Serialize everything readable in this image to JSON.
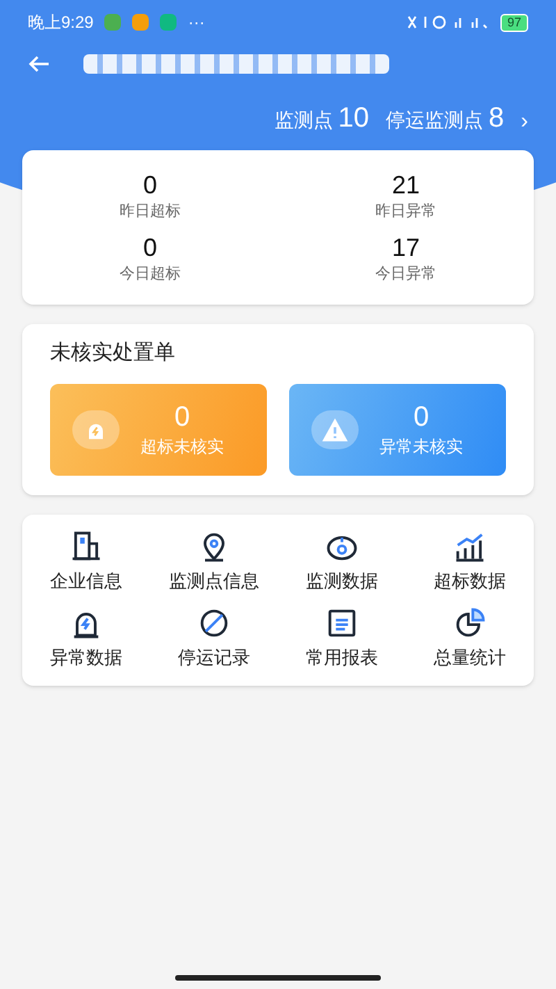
{
  "status_bar": {
    "time": "晚上9:29",
    "more": "···",
    "battery": "97"
  },
  "header": {
    "counts": [
      {
        "label": "监测点",
        "value": "10"
      },
      {
        "label": "停运监测点",
        "value": "8"
      }
    ],
    "chevron": "›"
  },
  "stats": [
    {
      "value": "0",
      "label": "昨日超标"
    },
    {
      "value": "21",
      "label": "昨日异常"
    },
    {
      "value": "0",
      "label": "今日超标"
    },
    {
      "value": "17",
      "label": "今日异常"
    }
  ],
  "pending": {
    "title": "未核实处置单",
    "tiles": [
      {
        "kind": "alarm",
        "value": "0",
        "label": "超标未核实"
      },
      {
        "kind": "warning",
        "value": "0",
        "label": "异常未核实"
      }
    ]
  },
  "menu": [
    {
      "kind": "building",
      "label": "企业信息"
    },
    {
      "kind": "pin",
      "label": "监测点信息"
    },
    {
      "kind": "eye",
      "label": "监测数据"
    },
    {
      "kind": "chart",
      "label": "超标数据"
    },
    {
      "kind": "alarm",
      "label": "异常数据"
    },
    {
      "kind": "ban",
      "label": "停运记录"
    },
    {
      "kind": "report",
      "label": "常用报表"
    },
    {
      "kind": "pie",
      "label": "总量统计"
    }
  ]
}
